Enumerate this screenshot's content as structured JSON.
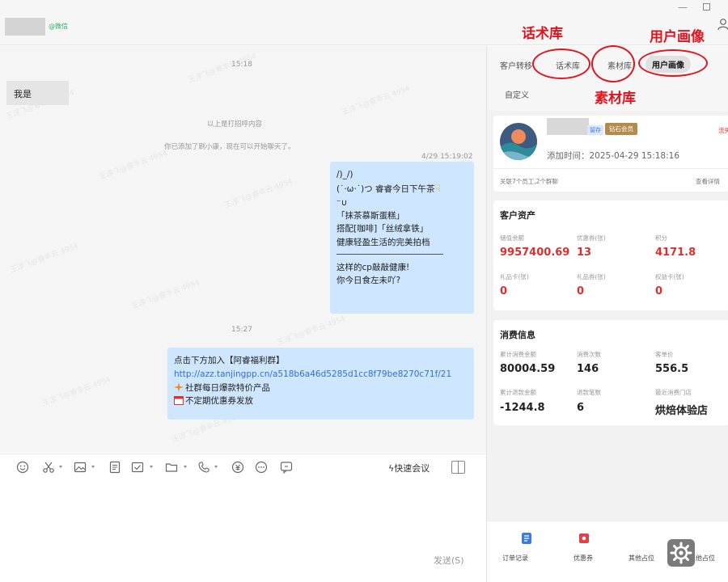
{
  "window": {
    "contact_tag": "@微信"
  },
  "annotations": {
    "huashu": "话术库",
    "portrait": "用户画像",
    "sucai": "素材库"
  },
  "chat": {
    "watermark": "王淳飞@睿丰云 4954",
    "ts1": "15:18",
    "bubble_me": "我是",
    "sys1": "以上是打招呼内容",
    "sys2": "你已添加了刷小康，现在可以开始聊天了。",
    "ts2": "4/29 15:19:02",
    "msg1": {
      "l1": "/)_/)",
      "l2": "(˙·ω·˙)つ 睿睿今日下午茶",
      "l3": "⁻∪",
      "l4": "「抹茶慕斯蛋糕」",
      "l5": "搭配[咖啡]「丝绒拿铁」",
      "l6": "健康轻盈生活的完美拍档",
      "l7": "这样的cp敲敲健康!",
      "l8": "你今日食左未吖?"
    },
    "ts3": "15:27",
    "msg2": {
      "l1": "点击下方加入【阿睿福利群】",
      "link": "http://azz.tanjingpp.cn/a518b6a46d5285d1cc8f79be8270c71f/21",
      "l2": "社群每日爆款特价产品",
      "l3": "不定期优惠券发放"
    }
  },
  "composer": {
    "quick_meeting": "快速会议",
    "send": "发送(S)"
  },
  "tabs": {
    "t1": "客户转移",
    "t2": "话术库",
    "t3": "素材库",
    "t4": "用户画像",
    "t5": "自定义"
  },
  "customer": {
    "tag_blue": "留存",
    "tag_gold": "钻石会员",
    "tag_red": "流失",
    "added": "添加时间：2025-04-29 15:18:16",
    "linked": "关联7个员工,2个群聊",
    "detail": "查看详情"
  },
  "assets": {
    "title": "客户资产",
    "items": [
      {
        "label": "储值余额",
        "value": "9957400.69"
      },
      {
        "label": "优惠券(张)",
        "value": "13"
      },
      {
        "label": "积分",
        "value": "4171.8"
      },
      {
        "label": "礼品卡(张)",
        "value": "0"
      },
      {
        "label": "礼品券(张)",
        "value": "0"
      },
      {
        "label": "权益卡(张)",
        "value": "0"
      }
    ]
  },
  "consume": {
    "title": "消费信息",
    "items": [
      {
        "label": "累计消费金额",
        "value": "80004.59"
      },
      {
        "label": "消费次数",
        "value": "146"
      },
      {
        "label": "客单价",
        "value": "556.5"
      },
      {
        "label": "累计退款金额",
        "value": "-1244.8"
      },
      {
        "label": "退款笔数",
        "value": "6"
      },
      {
        "label": "最近消费门店",
        "value": "烘焙体验店"
      }
    ]
  },
  "bottom": {
    "b1": "订单记录",
    "b2": "优惠券",
    "b3": "其他占位",
    "b4": "其他占位"
  },
  "colors": {
    "annotation": "#e0141e",
    "value_red": "#d93030",
    "bubble": "#cfe6ff",
    "link": "#2f6fd6",
    "tag_gold": "#b58a4d"
  }
}
